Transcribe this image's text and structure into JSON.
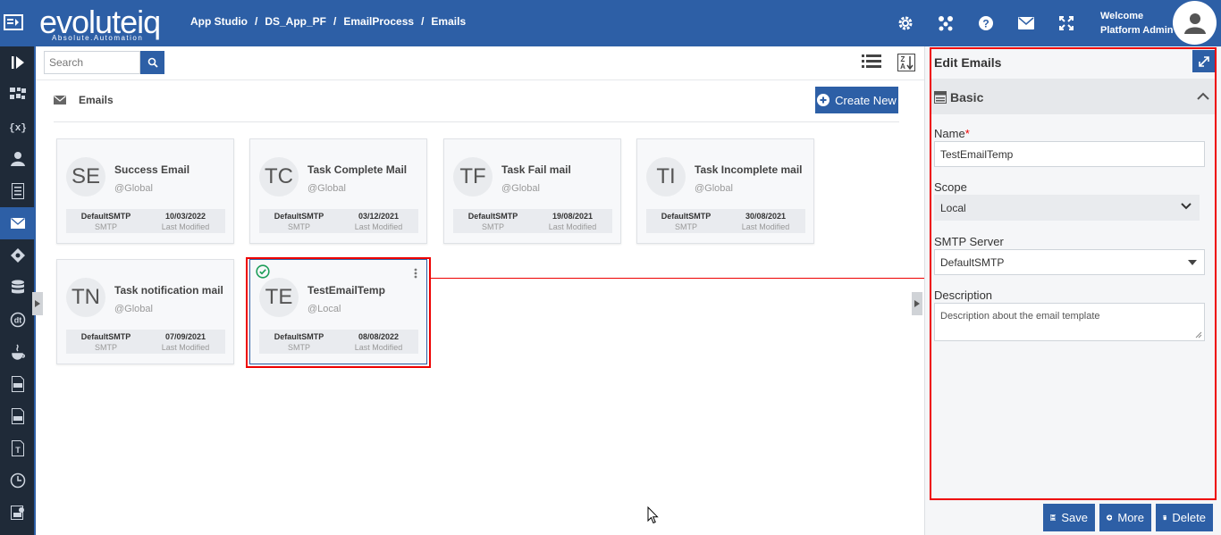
{
  "topbar": {
    "logo_text": "evoluteiq",
    "logo_tagline": "Absolute.Automation",
    "breadcrumb": [
      "App Studio",
      "DS_App_PF",
      "EmailProcess",
      "Emails"
    ],
    "separator": "/",
    "icons": [
      "gear-icon",
      "apps-icon",
      "help-icon",
      "mail-icon",
      "fullscreen-icon"
    ],
    "welcome_line1": "Welcome",
    "welcome_line2": "Platform Admin"
  },
  "rail": {
    "items": [
      "launch-icon",
      "process-icon",
      "variables-icon",
      "users-icon",
      "forms-icon",
      "email-icon",
      "rules-icon",
      "database-icon",
      "datatable-icon",
      "java-icon",
      "pdf-icon",
      "csv-icon",
      "text-icon",
      "clock-icon",
      "report-icon"
    ],
    "active_index": 5
  },
  "main": {
    "search_placeholder": "Search",
    "section_title": "Emails",
    "create_label": "Create New",
    "cards": [
      {
        "initials": "SE",
        "name": "Success Email",
        "scope": "@Global",
        "server": "DefaultSMTP",
        "server_label": "SMTP",
        "date": "10/03/2022",
        "date_label": "Last Modified"
      },
      {
        "initials": "TC",
        "name": "Task Complete Mail",
        "scope": "@Global",
        "server": "DefaultSMTP",
        "server_label": "SMTP",
        "date": "03/12/2021",
        "date_label": "Last Modified"
      },
      {
        "initials": "TF",
        "name": "Task Fail mail",
        "scope": "@Global",
        "server": "DefaultSMTP",
        "server_label": "SMTP",
        "date": "19/08/2021",
        "date_label": "Last Modified"
      },
      {
        "initials": "TI",
        "name": "Task Incomplete mail",
        "scope": "@Global",
        "server": "DefaultSMTP",
        "server_label": "SMTP",
        "date": "30/08/2021",
        "date_label": "Last Modified"
      },
      {
        "initials": "TN",
        "name": "Task notification mail",
        "scope": "@Global",
        "server": "DefaultSMTP",
        "server_label": "SMTP",
        "date": "07/09/2021",
        "date_label": "Last Modified"
      },
      {
        "initials": "TE",
        "name": "TestEmailTemp",
        "scope": "@Local",
        "server": "DefaultSMTP",
        "server_label": "SMTP",
        "date": "08/08/2022",
        "date_label": "Last Modified"
      }
    ],
    "selected_index": 5
  },
  "panel": {
    "title": "Edit Emails",
    "section": "Basic",
    "name_label": "Name",
    "name_required": "*",
    "name_value": "TestEmailTemp",
    "scope_label": "Scope",
    "scope_value": "Local",
    "smtp_label": "SMTP Server",
    "smtp_value": "DefaultSMTP",
    "description_label": "Description",
    "description_value": "Description about the email template",
    "save_label": "Save",
    "more_label": "More",
    "delete_label": "Delete"
  },
  "colors": {
    "brand": "#2d5fa6",
    "rail": "#1f2a38",
    "highlight": "#ee0000",
    "check": "#1e9e5a"
  }
}
